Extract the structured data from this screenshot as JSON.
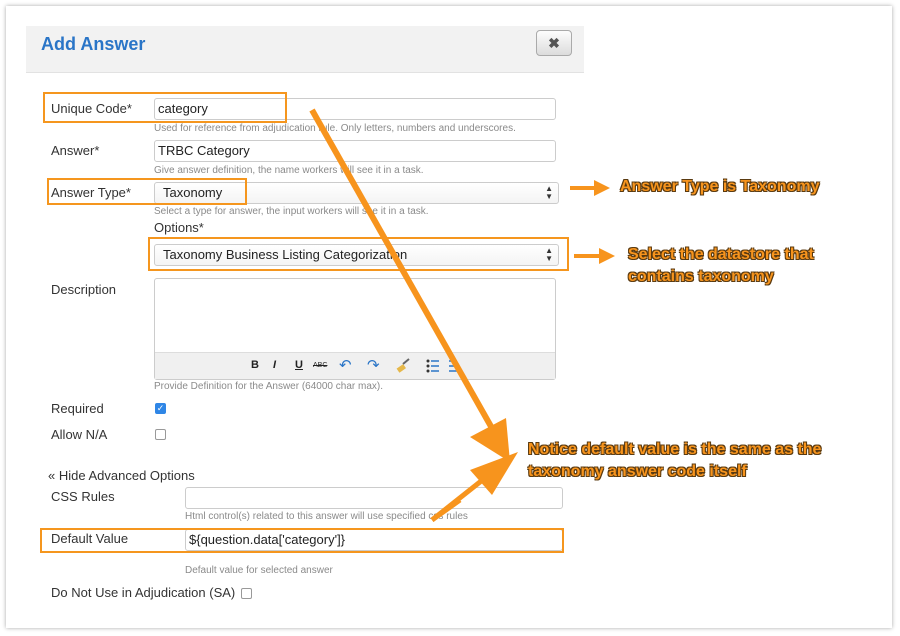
{
  "modal": {
    "title": "Add Answer",
    "close_label": "✖"
  },
  "form": {
    "unique_code": {
      "label": "Unique Code*",
      "value": "category",
      "help": "Used for reference from adjudication rule. Only letters, numbers and underscores."
    },
    "answer": {
      "label": "Answer*",
      "value": "TRBC Category",
      "help": "Give answer definition, the name workers will see it in a task."
    },
    "answer_type": {
      "label": "Answer Type*",
      "value": "Taxonomy",
      "help": "Select a type for answer, the input workers will see it in a task."
    },
    "options": {
      "label": "Options*",
      "value": "Taxonomy Business Listing Categorization"
    },
    "description": {
      "label": "Description",
      "help": "Provide Definition for the Answer (64000 char max)."
    },
    "required": {
      "label": "Required",
      "checked": true
    },
    "allow_na": {
      "label": "Allow N/A",
      "checked": false
    },
    "advanced_toggle": "« Hide Advanced Options",
    "css_rules": {
      "label": "CSS Rules",
      "value": "",
      "help": "Html control(s) related to this answer will use specified css rules"
    },
    "default_value": {
      "label": "Default Value",
      "value": "${question.data['category']}",
      "help": "Default value for selected answer"
    },
    "do_not_use": {
      "label": "Do Not Use in Adjudication (SA)",
      "checked": false
    }
  },
  "toolbar": {
    "bold": "B",
    "italic": "I",
    "underline": "U",
    "strike": "ABC",
    "undo": "↶",
    "redo": "↷"
  },
  "callouts": {
    "answer_type": "Answer Type is Taxonomy",
    "datastore_line1": "Select the datastore that",
    "datastore_line2": "contains taxonomy",
    "default_line1": "Notice default value is the same as the",
    "default_line2": "taxonomy answer code itself"
  },
  "colors": {
    "accent": "#2a75c7",
    "highlight": "#f5961e",
    "checkbox": "#2f86e6"
  }
}
